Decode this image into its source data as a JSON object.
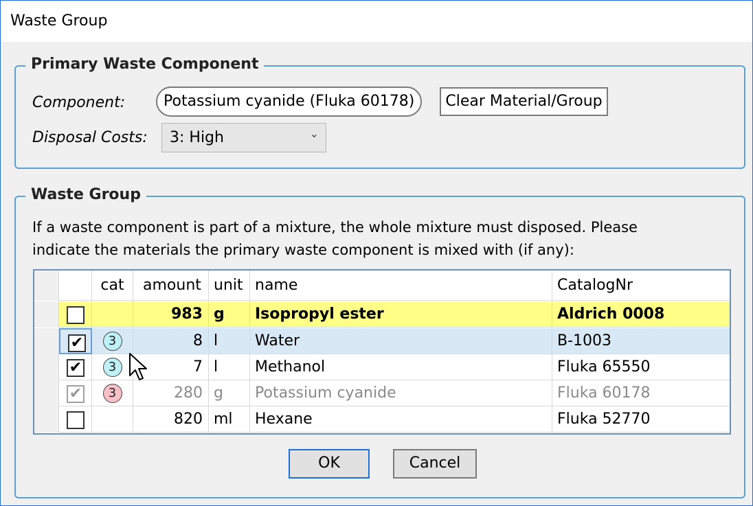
{
  "window": {
    "title": "Waste Group"
  },
  "primary": {
    "legend": "Primary Waste Component",
    "component_label": "Component:",
    "component_value": "Potassium cyanide (Fluka 60178)",
    "clear_button": "Clear Material/Group",
    "disposal_label": "Disposal Costs:",
    "disposal_value": "3: High",
    "dropdown_icon": "chevron-down-icon"
  },
  "group": {
    "legend": "Waste Group",
    "description_line1": "If a waste component is part of a mixture, the whole mixture must disposed. Please",
    "description_line2": "indicate the materials the primary waste component is mixed with (if any):"
  },
  "table": {
    "columns": [
      "",
      "cat",
      "amount",
      "unit",
      "name",
      "CatalogNr"
    ],
    "rows": [
      {
        "checked": false,
        "cat": "",
        "cat_color": "",
        "amount": "983",
        "unit": "g",
        "name": "Isopropyl ester",
        "catalog": "Aldrich 0008"
      },
      {
        "checked": true,
        "cat": "3",
        "cat_color": "#bff0f5",
        "amount": "8",
        "unit": "l",
        "name": "Water",
        "catalog": "B-1003"
      },
      {
        "checked": true,
        "cat": "3",
        "cat_color": "#bff0f5",
        "amount": "7",
        "unit": "l",
        "name": "Methanol",
        "catalog": "Fluka 65550"
      },
      {
        "checked": true,
        "cat": "3",
        "cat_color": "#f7c0c8",
        "amount": "280",
        "unit": "g",
        "name": "Potassium cyanide",
        "catalog": "Fluka 60178"
      },
      {
        "checked": false,
        "cat": "",
        "cat_color": "",
        "amount": "820",
        "unit": "ml",
        "name": "Hexane",
        "catalog": "Fluka 52770"
      }
    ]
  },
  "buttons": {
    "ok": "OK",
    "cancel": "Cancel"
  },
  "colors": {
    "accent": "#1e6ed6",
    "highlight_row": "#ffff88",
    "selected_row": "#d8e8f4"
  }
}
